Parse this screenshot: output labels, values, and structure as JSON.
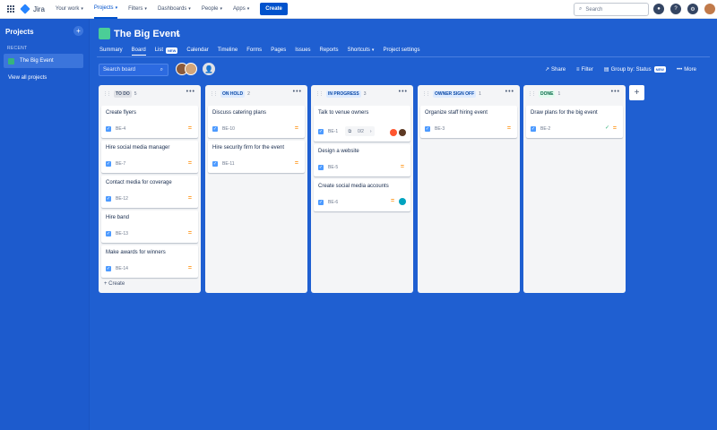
{
  "topnav": {
    "logo": "Jira",
    "items": [
      {
        "label": "Your work"
      },
      {
        "label": "Projects"
      },
      {
        "label": "Filters"
      },
      {
        "label": "Dashboards"
      },
      {
        "label": "People"
      },
      {
        "label": "Apps"
      }
    ],
    "create_label": "Create",
    "search_placeholder": "Search"
  },
  "sidebar": {
    "title": "Projects",
    "recent_label": "RECENT",
    "project_name": "The Big Event",
    "view_all": "View all projects"
  },
  "project": {
    "title": "The Big Event",
    "tabs": [
      {
        "label": "Summary"
      },
      {
        "label": "Board"
      },
      {
        "label": "List",
        "badge": "NEW"
      },
      {
        "label": "Calendar"
      },
      {
        "label": "Timeline"
      },
      {
        "label": "Forms"
      },
      {
        "label": "Pages"
      },
      {
        "label": "Issues"
      },
      {
        "label": "Reports"
      },
      {
        "label": "Shortcuts"
      },
      {
        "label": "Project settings"
      }
    ]
  },
  "board": {
    "search_placeholder": "Search board",
    "share_label": "Share",
    "filter_label": "Filter",
    "group_by_label": "Group by: Status",
    "group_by_badge": "NEW",
    "more_label": "More",
    "columns": [
      {
        "name": "TO DO",
        "count": "5",
        "name_bg": "#dfe1e6",
        "name_color": "#42526e",
        "create_label": "+ Create",
        "cards": [
          {
            "title": "Create flyers",
            "key": "BE-4"
          },
          {
            "title": "Hire social media manager",
            "key": "BE-7"
          },
          {
            "title": "Contact media for coverage",
            "key": "BE-12"
          },
          {
            "title": "Hire band",
            "key": "BE-13"
          },
          {
            "title": "Make awards for winners",
            "key": "BE-14"
          }
        ]
      },
      {
        "name": "ON HOLD",
        "count": "2",
        "name_bg": "#deebff",
        "name_color": "#0747a6",
        "cards": [
          {
            "title": "Discuss catering plans",
            "key": "BE-10"
          },
          {
            "title": "Hire security firm for the event",
            "key": "BE-11"
          }
        ]
      },
      {
        "name": "IN PROGRESS",
        "count": "3",
        "name_bg": "#deebff",
        "name_color": "#0747a6",
        "cards": [
          {
            "title": "Talk to venue owners",
            "key": "BE-1",
            "subtasks": "0/2"
          },
          {
            "title": "Design a website",
            "key": "BE-5"
          },
          {
            "title": "Create social media accounts",
            "key": "BE-6"
          }
        ]
      },
      {
        "name": "OWNER SIGN OFF",
        "count": "1",
        "name_bg": "#deebff",
        "name_color": "#0747a6",
        "cards": [
          {
            "title": "Organize staff hiring event",
            "key": "BE-3"
          }
        ]
      },
      {
        "name": "DONE",
        "count": "1",
        "name_bg": "#e3fcef",
        "name_color": "#006644",
        "cards": [
          {
            "title": "Draw plans for the big event",
            "key": "BE-2"
          }
        ]
      }
    ]
  },
  "colors": {
    "brand_blue": "#0052cc",
    "page_bg": "#1f5fd1",
    "priority": "#ff991f"
  }
}
